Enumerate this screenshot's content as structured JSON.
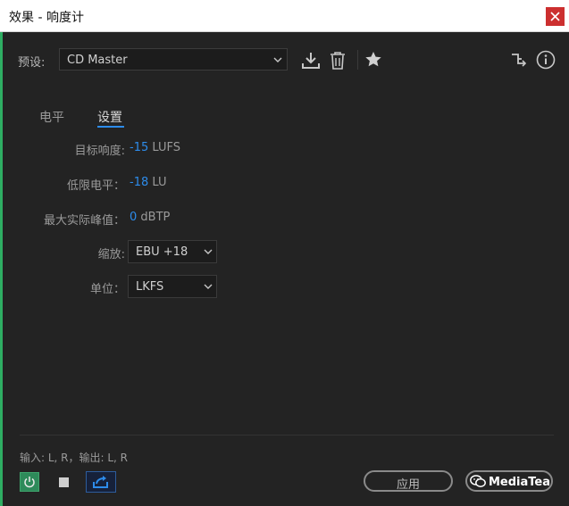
{
  "window": {
    "title": "效果 - 响度计"
  },
  "preset": {
    "label": "预设:",
    "value": "CD Master"
  },
  "tabs": [
    {
      "label": "电平"
    },
    {
      "label": "设置"
    }
  ],
  "settings": {
    "target": {
      "label": "目标响度:",
      "value": "-15",
      "unit": "LUFS"
    },
    "limit": {
      "label": "低限电平：",
      "value": "-18",
      "unit": "LU"
    },
    "peak": {
      "label": "最大实际峰值：",
      "value": "0",
      "unit": "dBTP"
    },
    "scale": {
      "label": "缩放:",
      "value": "EBU +18"
    },
    "unit": {
      "label": "单位：",
      "value": "LKFS"
    }
  },
  "footer": {
    "io": "输入: L, R，输出: L, R",
    "apply": "应用",
    "watermark": "MediaTea"
  },
  "icons": [
    "close-icon",
    "download-icon",
    "trash-icon",
    "star-icon",
    "routing-icon",
    "info-icon",
    "chevron-down-icon",
    "power-icon",
    "stop-icon",
    "route-icon",
    "wechat-icon"
  ],
  "colors": {
    "accent": "#2d8ceb",
    "power": "#2e8a5a",
    "close": "#cc2f2f"
  }
}
